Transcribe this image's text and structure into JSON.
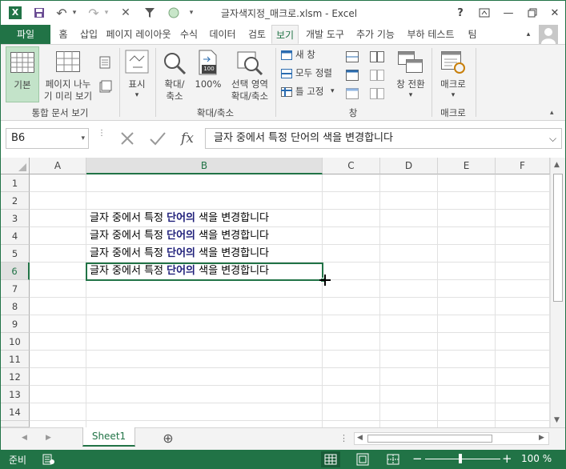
{
  "titlebar": {
    "title": "글자색지정_매크로.xlsm - Excel",
    "help": "?",
    "minimize": "—",
    "close": "✕"
  },
  "tabs": {
    "file": "파일",
    "items": [
      "홈",
      "삽입",
      "페이지 레이아웃",
      "수식",
      "데이터",
      "검토",
      "보기",
      "개발 도구",
      "추가 기능",
      "부하 테스트",
      "팀"
    ],
    "active": "보기"
  },
  "ribbon": {
    "normal": "기본",
    "page_break_l1": "페이지 나누",
    "page_break_l2": "기 미리 보기",
    "show": "표시",
    "zoom_l1": "확대/",
    "zoom_l2": "축소",
    "zoom100": "100%",
    "zoom_sel_l1": "선택 영역",
    "zoom_sel_l2": "확대/축소",
    "new_window": "새 창",
    "arrange_all": "모두 정렬",
    "freeze": "틀 고정",
    "switch_windows": "창 전환",
    "macros": "매크로",
    "group_views": "통합 문서 보기",
    "group_zoom": "확대/축소",
    "group_window": "창",
    "group_macros": "매크로",
    "zoom100_badge": "100"
  },
  "formula_bar": {
    "name_box": "B6",
    "fx": "fx",
    "formula": "글자 중에서 특정 단어의 색을 변경합니다"
  },
  "grid": {
    "columns": [
      "A",
      "B",
      "C",
      "D",
      "E",
      "F"
    ],
    "rows": [
      "1",
      "2",
      "3",
      "4",
      "5",
      "6",
      "7",
      "8",
      "9",
      "10",
      "11",
      "12",
      "13",
      "14"
    ],
    "cell_text": {
      "pre": "글자 중에서 특정 ",
      "highlight": "단어의",
      "post": " 색을 변경합니다"
    },
    "highlight_color": "#1f1f7a",
    "selected_cell": "B6"
  },
  "sheets": {
    "tabs": [
      "Sheet1"
    ],
    "add": "⊕"
  },
  "status": {
    "ready": "준비",
    "zoom": "100 %",
    "accent": "#217346"
  }
}
